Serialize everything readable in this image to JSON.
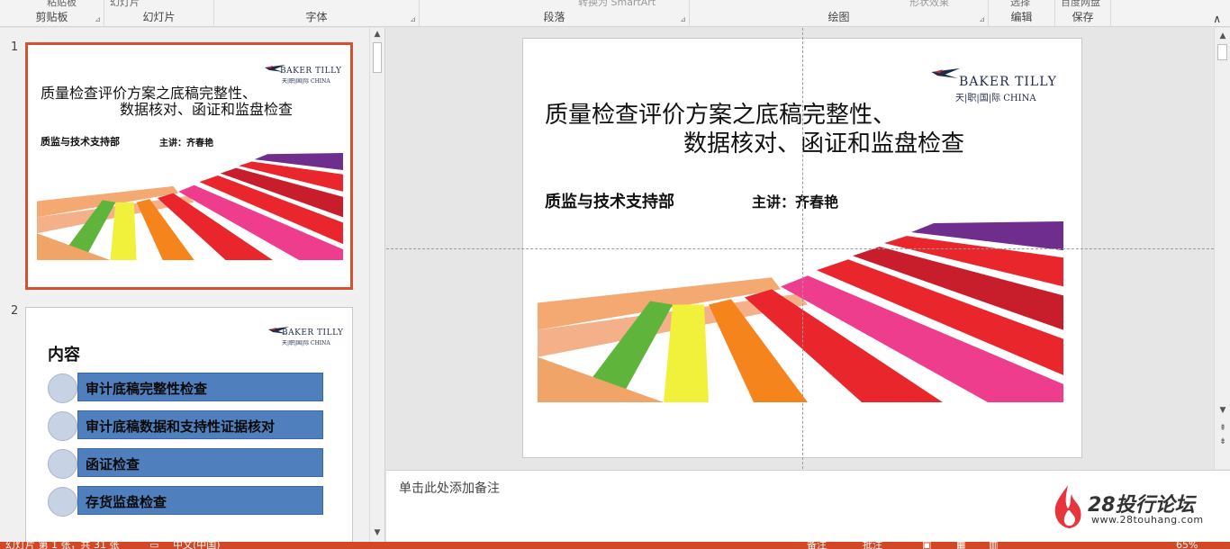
{
  "ribbon": {
    "groups": [
      {
        "label": "剪贴板",
        "cut": "粘贴板"
      },
      {
        "label": "幻灯片",
        "cut": "幻灯片"
      },
      {
        "label": "字体",
        "cut": ""
      },
      {
        "label": "段落",
        "cut": "转换为 SmartArt"
      },
      {
        "label": "绘图",
        "cut": "形状效果"
      },
      {
        "label": "编辑",
        "cut": "选择"
      },
      {
        "label": "保存",
        "cut": "百度网盘"
      }
    ]
  },
  "thumbnails": [
    {
      "number": "1"
    },
    {
      "number": "2"
    }
  ],
  "slide1": {
    "logo_name": "BAKER TILLY",
    "logo_sub": "天|职|国|际 CHINA",
    "title_line1": "质量检查评价方案之底稿完整性、",
    "title_line2": "数据核对、函证和监盘检查",
    "department": "质监与技术支持部",
    "speaker": "主讲：齐春艳"
  },
  "slide2": {
    "logo_name": "BAKER TILLY",
    "logo_sub": "天|职|国|际 CHINA",
    "heading": "内容",
    "items": [
      "审计底稿完整性检查",
      "审计底稿数据和支持性证据核对",
      "函证检查",
      "存货监盘检查"
    ]
  },
  "notes": {
    "placeholder": "单击此处添加备注"
  },
  "watermark": {
    "title": "28投行论坛",
    "url": "www.28touhang.com"
  },
  "statusbar": {
    "slide_info": "幻灯片 第 1 张，共 31 张",
    "language": "中文(中国)",
    "notes_btn": "备注",
    "comments_btn": "批注",
    "zoom": "65%"
  },
  "colors": {
    "accent": "#d24726",
    "selected_border": "#d35230",
    "toc_bar": "#4f7fbd",
    "toc_circle": "#c7d3e4"
  }
}
